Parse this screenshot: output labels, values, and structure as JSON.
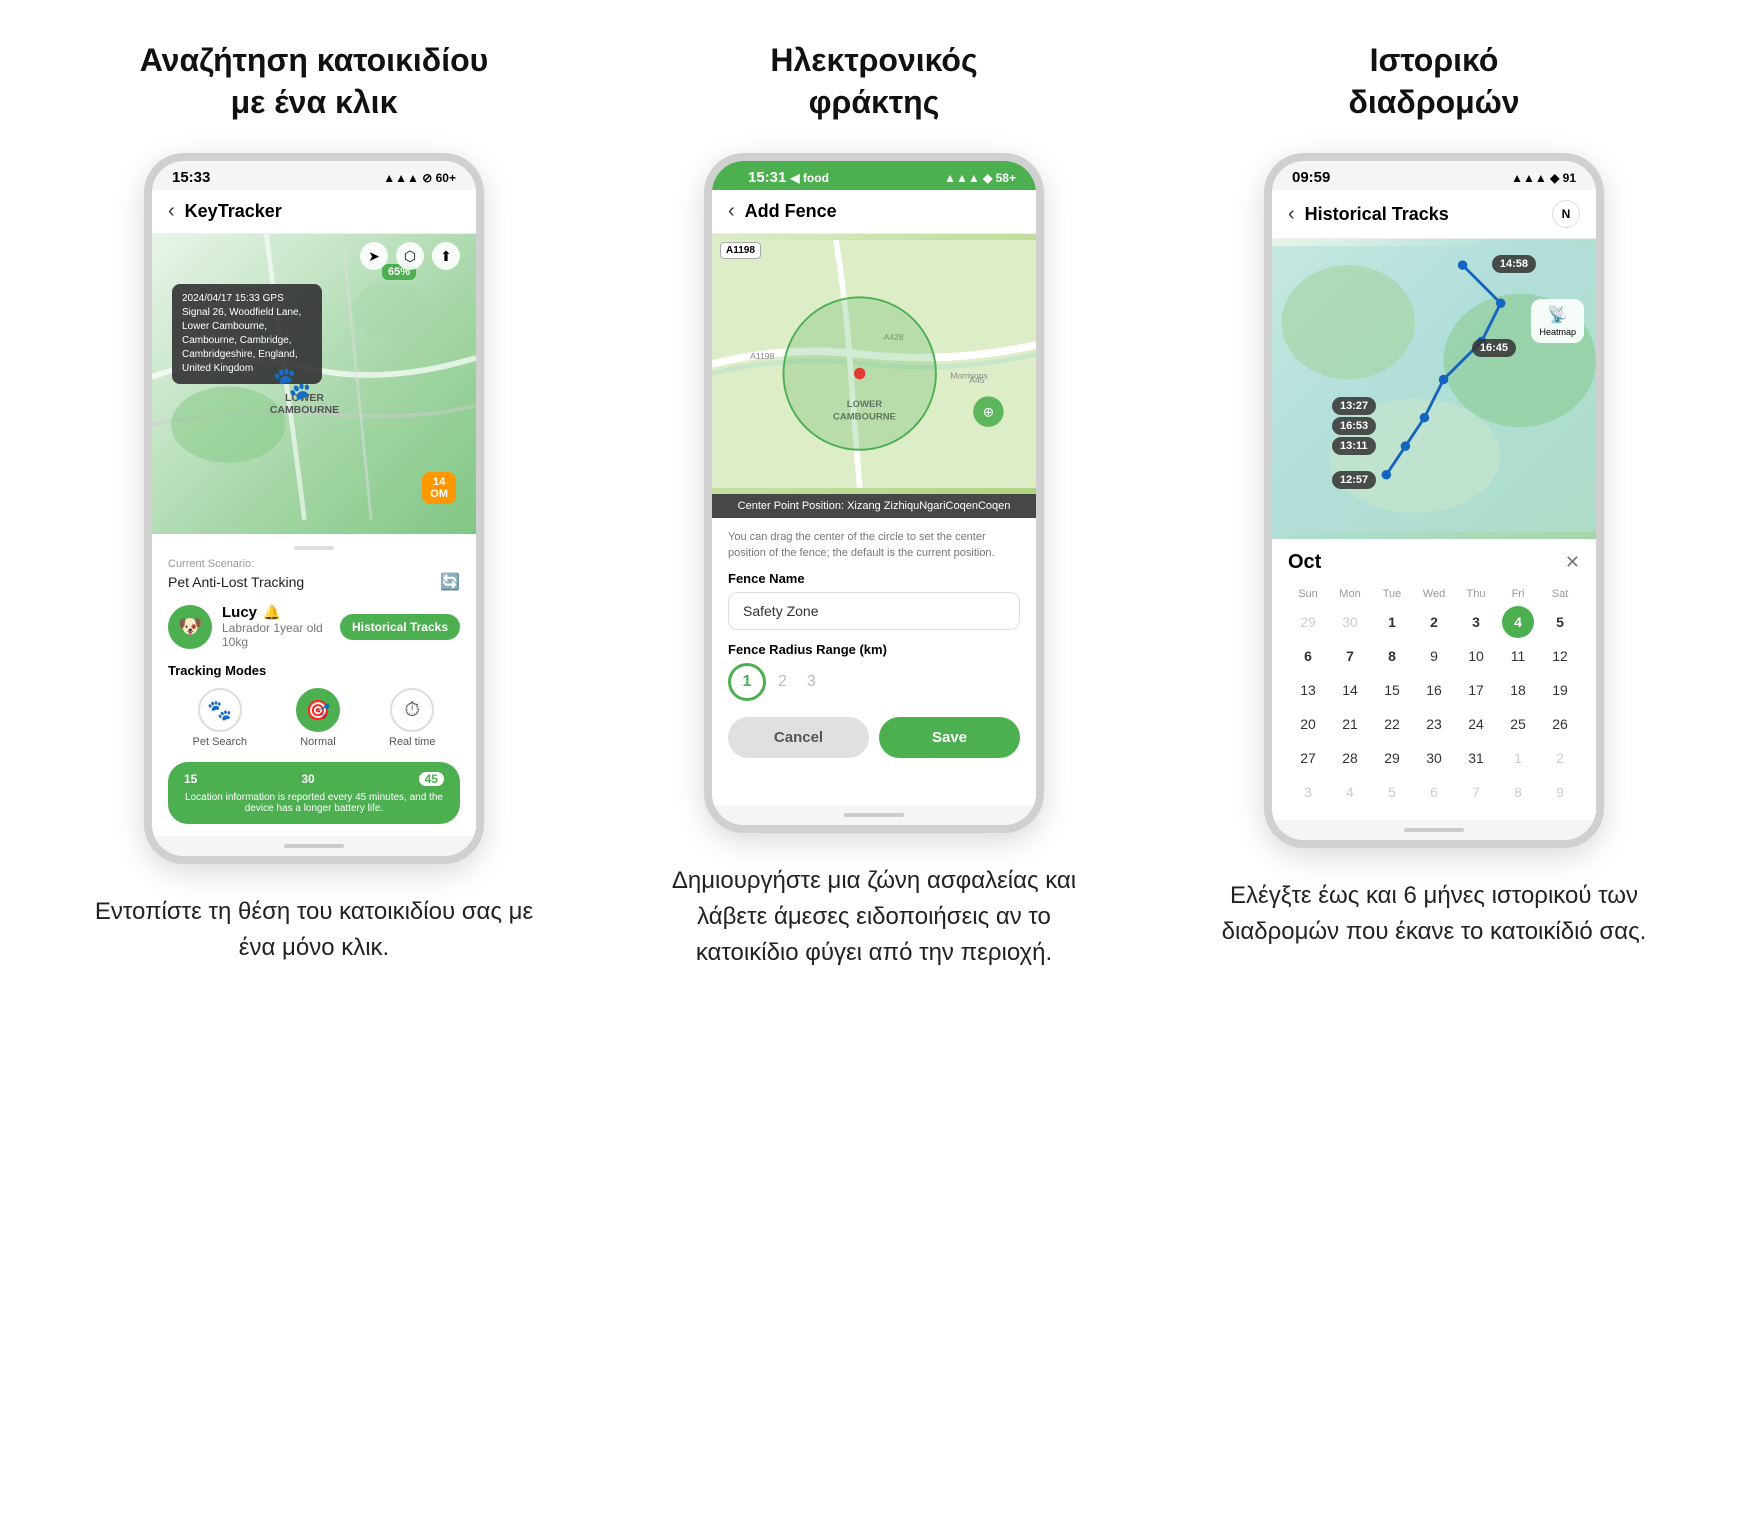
{
  "columns": [
    {
      "id": "col1",
      "title": "Αναζήτηση κατοικιδίου\nμε ένα κλικ",
      "desc": "Εντοπίστε τη θέση του κατοικιδίου σας με ένα μόνο κλικ.",
      "phone": {
        "status_time": "15:33",
        "status_icons": "▲▲▲ ◆ 60+",
        "nav_title": "KeyTracker",
        "map_popup": "2024/04/17 15:33 GPS Signal 26, Woodfield Lane, Lower Cambourne, Cambourne, Cambridge, Cambridgeshire, England, United Kingdom",
        "map_badge_green": "65%",
        "map_badge_orange": "14\nOM",
        "scenario_label": "Current Scenario:",
        "scenario_value": "Pet Anti-Lost Tracking",
        "pet_name": "Lucy",
        "pet_breed": "Labrador 1year old 10kg",
        "hist_btn": "Historical Tracks",
        "tracking_modes_title": "Tracking Modes",
        "mode1": "Pet Search",
        "mode2": "Normal",
        "mode3": "Real time",
        "slider_values": [
          "15",
          "30",
          "45"
        ],
        "slider_text": "Location information is reported every 45 minutes, and the device has a longer battery life."
      }
    },
    {
      "id": "col2",
      "title": "Ηλεκτρονικός\nφράκτης",
      "desc": "Δημιουργήστε μια ζώνη ασφαλείας και λάβετε άμεσες ειδοποιήσεις αν το κατοικίδιο φύγει από την περιοχή.",
      "phone": {
        "status_time": "15:31",
        "status_icons": "▲▲▲ ◆ 58+",
        "nav_title": "Add Fence",
        "center_pos": "Center Point Position: Xizang ZizhiquNgariCoqenCoqen",
        "form_hint": "You can drag the center of the circle to set the center position of the fence; the default is the current position.",
        "fence_name_label": "Fence Name",
        "fence_name_value": "Safety Zone",
        "radius_label": "Fence Radius Range (km)",
        "radius_1": "1",
        "radius_2": "2",
        "radius_3": "3",
        "btn_cancel": "Cancel",
        "btn_save": "Save"
      }
    },
    {
      "id": "col3",
      "title": "Ιστορικό\nδιαδρομών",
      "desc": "Ελέγξτε έως και 6 μήνες ιστορικού των διαδρομών που έκανε το κατοικίδιό σας.",
      "phone": {
        "status_time": "09:59",
        "status_icons": "▲▲▲ ◆ 91",
        "nav_title": "Historical Tracks",
        "time_badges": [
          "14:58",
          "16:45",
          "13:27",
          "16:53",
          "13:11",
          "12:57"
        ],
        "cal_month": "Oct",
        "cal_days_header": [
          "Sun",
          "Mon",
          "Tue",
          "Wed",
          "Thu",
          "Fri",
          "Sat"
        ],
        "cal_rows": [
          [
            "29",
            "30",
            "1",
            "2",
            "3",
            "4",
            "5"
          ],
          [
            "6",
            "7",
            "8",
            "9",
            "10",
            "11",
            "12"
          ],
          [
            "13",
            "14",
            "15",
            "16",
            "17",
            "18",
            "19"
          ],
          [
            "20",
            "21",
            "22",
            "23",
            "24",
            "25",
            "26"
          ],
          [
            "27",
            "28",
            "29",
            "30",
            "31",
            "1",
            "2"
          ],
          [
            "3",
            "4",
            "5",
            "6",
            "7",
            "8",
            "9"
          ]
        ],
        "today": "4"
      }
    }
  ]
}
